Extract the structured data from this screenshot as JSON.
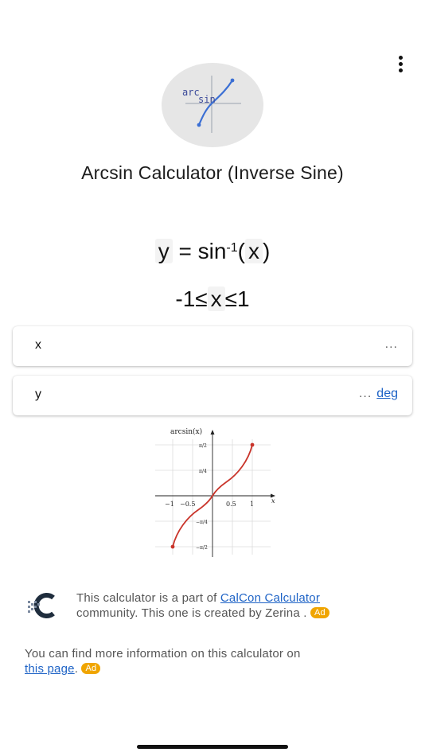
{
  "logo": {
    "line1": "arc",
    "line2": "sin"
  },
  "title": "Arcsin Calculator (Inverse Sine)",
  "formula": {
    "y": "y",
    "eq": "=",
    "fn": "sin",
    "exp": "-1",
    "open": "(",
    "x": "x",
    "close": ")"
  },
  "range": {
    "low": "-1",
    "le1": "≤",
    "x": "x",
    "le2": "≤",
    "high": "1"
  },
  "fields": [
    {
      "label": "x",
      "value": "...",
      "unit": ""
    },
    {
      "label": "y",
      "value": "...",
      "unit": "deg"
    }
  ],
  "graph": {
    "ylabel": "arcsin(x)",
    "xlabel": "x",
    "xticks": [
      "−1",
      "−0.5",
      "0.5",
      "1"
    ],
    "yticks": [
      "π/2",
      "π/4",
      "−π/4",
      "−π/2"
    ]
  },
  "community": {
    "text1": "This calculator is a part of",
    "link": "CalCon Calculator",
    "text2": "community. This one is created by Zerina .",
    "ad": "Ad"
  },
  "moreinfo": {
    "text": "You can find more information on this calculator on",
    "link": "this page",
    "suffix": ".",
    "ad": "Ad"
  },
  "icons": {
    "menu": "more-vertical-icon",
    "logo": "arcsin-logo-icon",
    "brand": "calcon-logo-icon"
  },
  "colors": {
    "accent": "#1e63c6",
    "curve": "#c9342a",
    "ad": "#f0a500",
    "logo_curve": "#3b6fd4"
  }
}
